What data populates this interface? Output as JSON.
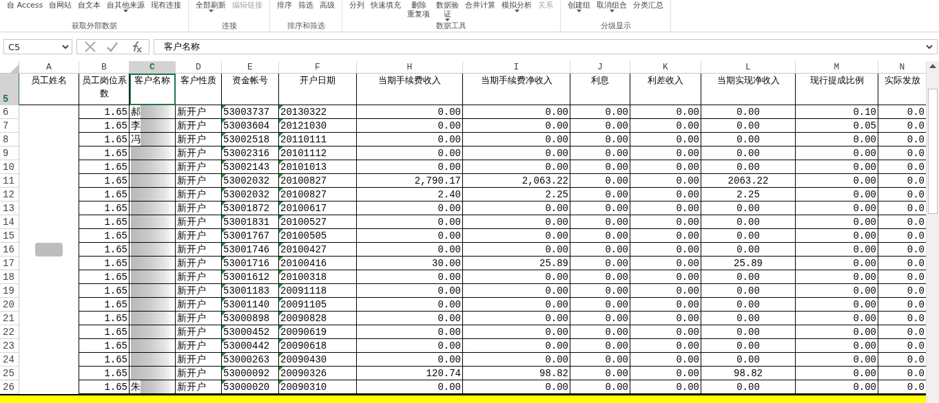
{
  "ribbon": {
    "groups": [
      {
        "label": "获取外部数据",
        "commands": [
          {
            "lines": [
              "自 Access"
            ],
            "dropdown": false,
            "disabled": false
          },
          {
            "lines": [
              "自网站"
            ],
            "dropdown": false,
            "disabled": false
          },
          {
            "lines": [
              "自文本"
            ],
            "dropdown": false,
            "disabled": false
          },
          {
            "lines": [
              "自其他来源"
            ],
            "dropdown": true,
            "disabled": false
          },
          {
            "lines": [
              "现有连接"
            ],
            "dropdown": false,
            "disabled": false
          }
        ]
      },
      {
        "label": "连接",
        "commands": [
          {
            "lines": [
              "全部刷新"
            ],
            "dropdown": true,
            "disabled": false
          },
          {
            "lines": [
              "编辑链接"
            ],
            "dropdown": false,
            "disabled": true
          }
        ]
      },
      {
        "label": "排序和筛选",
        "commands": [
          {
            "lines": [
              "排序"
            ],
            "dropdown": false,
            "disabled": false
          },
          {
            "lines": [
              "筛选"
            ],
            "dropdown": false,
            "disabled": false
          },
          {
            "lines": [
              "高级"
            ],
            "dropdown": false,
            "disabled": false
          }
        ]
      },
      {
        "label": "数据工具",
        "commands": [
          {
            "lines": [
              "分列"
            ],
            "dropdown": false,
            "disabled": false
          },
          {
            "lines": [
              "快速填充"
            ],
            "dropdown": false,
            "disabled": false
          },
          {
            "lines": [
              "删除",
              "重复项"
            ],
            "dropdown": false,
            "disabled": false
          },
          {
            "lines": [
              "数据验",
              "证"
            ],
            "dropdown": true,
            "disabled": false
          },
          {
            "lines": [
              "合并计算"
            ],
            "dropdown": false,
            "disabled": false
          },
          {
            "lines": [
              "模拟分析"
            ],
            "dropdown": true,
            "disabled": false
          },
          {
            "lines": [
              "关系"
            ],
            "dropdown": false,
            "disabled": true
          }
        ]
      },
      {
        "label": "分级显示",
        "commands": [
          {
            "lines": [
              "创建组"
            ],
            "dropdown": true,
            "disabled": false
          },
          {
            "lines": [
              "取消组合"
            ],
            "dropdown": true,
            "disabled": false
          },
          {
            "lines": [
              "分类汇总"
            ],
            "dropdown": false,
            "disabled": false
          }
        ]
      }
    ]
  },
  "formula_bar": {
    "name_box": "C5",
    "formula": "客户名称"
  },
  "columns": [
    {
      "letter": "A",
      "selected": false
    },
    {
      "letter": "B",
      "selected": false
    },
    {
      "letter": "C",
      "selected": true
    },
    {
      "letter": "D",
      "selected": false
    },
    {
      "letter": "E",
      "selected": false
    },
    {
      "letter": "F",
      "selected": false
    },
    {
      "letter": "H",
      "selected": false
    },
    {
      "letter": "I",
      "selected": false
    },
    {
      "letter": "J",
      "selected": false
    },
    {
      "letter": "K",
      "selected": false
    },
    {
      "letter": "L",
      "selected": false
    },
    {
      "letter": "M",
      "selected": false
    },
    {
      "letter": "N",
      "selected": false
    }
  ],
  "header_row": {
    "number": "5",
    "selected": true,
    "labels": [
      "员工姓名",
      "员工岗位系数",
      "客户名称",
      "客户性质",
      "资金帐号",
      "开户日期",
      "当期手续费收入",
      "当期手续费净收入",
      "利息",
      "利差收入",
      "当期实现净收入",
      "现行提成比例",
      "实际发放"
    ]
  },
  "rows": [
    {
      "number": "6",
      "coef": "1.65",
      "customer": "郝",
      "nature": "新开户",
      "account": "53003737",
      "date": "20130322",
      "fee": "0.00",
      "net_fee": "0.00",
      "interest": "0.00",
      "spread": "0.00",
      "net_income": "0.00",
      "rate": "0.10",
      "actual": "0.0"
    },
    {
      "number": "7",
      "coef": "1.65",
      "customer": "李",
      "nature": "新开户",
      "account": "53003604",
      "date": "20121030",
      "fee": "0.00",
      "net_fee": "0.00",
      "interest": "0.00",
      "spread": "0.00",
      "net_income": "0.00",
      "rate": "0.05",
      "actual": "0.0"
    },
    {
      "number": "8",
      "coef": "1.65",
      "customer": "冯",
      "nature": "新开户",
      "account": "53002518",
      "date": "20110111",
      "fee": "0.00",
      "net_fee": "0.00",
      "interest": "0.00",
      "spread": "0.00",
      "net_income": "0.00",
      "rate": "0.00",
      "actual": "0.0"
    },
    {
      "number": "9",
      "coef": "1.65",
      "nature": "新开户",
      "account": "53002316",
      "date": "20101112",
      "fee": "0.00",
      "net_fee": "0.00",
      "interest": "0.00",
      "spread": "0.00",
      "net_income": "0.00",
      "rate": "0.00",
      "actual": "0.0"
    },
    {
      "number": "10",
      "coef": "1.65",
      "nature": "新开户",
      "account": "53002143",
      "date": "20101013",
      "fee": "0.00",
      "net_fee": "0.00",
      "interest": "0.00",
      "spread": "0.00",
      "net_income": "0.00",
      "rate": "0.00",
      "actual": "0.0"
    },
    {
      "number": "11",
      "coef": "1.65",
      "nature": "新开户",
      "account": "53002032",
      "date": "20100827",
      "fee": "2,790.17",
      "net_fee": "2,063.22",
      "interest": "0.00",
      "spread": "0.00",
      "net_income": "2063.22",
      "rate": "0.00",
      "actual": "0.0"
    },
    {
      "number": "12",
      "coef": "1.65",
      "nature": "新开户",
      "account": "53002032",
      "date": "20100827",
      "fee": "2.40",
      "net_fee": "2.25",
      "interest": "0.00",
      "spread": "0.00",
      "net_income": "2.25",
      "rate": "0.00",
      "actual": "0.0"
    },
    {
      "number": "13",
      "coef": "1.65",
      "nature": "新开户",
      "account": "53001872",
      "date": "20100617",
      "fee": "0.00",
      "net_fee": "0.00",
      "interest": "0.00",
      "spread": "0.00",
      "net_income": "0.00",
      "rate": "0.00",
      "actual": "0.0"
    },
    {
      "number": "14",
      "coef": "1.65",
      "nature": "新开户",
      "account": "53001831",
      "date": "20100527",
      "fee": "0.00",
      "net_fee": "0.00",
      "interest": "0.00",
      "spread": "0.00",
      "net_income": "0.00",
      "rate": "0.00",
      "actual": "0.0"
    },
    {
      "number": "15",
      "coef": "1.65",
      "nature": "新开户",
      "account": "53001767",
      "date": "20100505",
      "fee": "0.00",
      "net_fee": "0.00",
      "interest": "0.00",
      "spread": "0.00",
      "net_income": "0.00",
      "rate": "0.00",
      "actual": "0.0"
    },
    {
      "number": "16",
      "coef": "1.65",
      "nature": "新开户",
      "account": "53001746",
      "date": "20100427",
      "fee": "0.00",
      "net_fee": "0.00",
      "interest": "0.00",
      "spread": "0.00",
      "net_income": "0.00",
      "rate": "0.00",
      "actual": "0.0"
    },
    {
      "number": "17",
      "coef": "1.65",
      "nature": "新开户",
      "account": "53001716",
      "date": "20100416",
      "fee": "30.00",
      "net_fee": "25.89",
      "interest": "0.00",
      "spread": "0.00",
      "net_income": "25.89",
      "rate": "0.00",
      "actual": "0.0"
    },
    {
      "number": "18",
      "coef": "1.65",
      "nature": "新开户",
      "account": "53001612",
      "date": "20100318",
      "fee": "0.00",
      "net_fee": "0.00",
      "interest": "0.00",
      "spread": "0.00",
      "net_income": "0.00",
      "rate": "0.00",
      "actual": "0.0"
    },
    {
      "number": "19",
      "coef": "1.65",
      "nature": "新开户",
      "account": "53001183",
      "date": "20091118",
      "fee": "0.00",
      "net_fee": "0.00",
      "interest": "0.00",
      "spread": "0.00",
      "net_income": "0.00",
      "rate": "0.00",
      "actual": "0.0"
    },
    {
      "number": "20",
      "coef": "1.65",
      "nature": "新开户",
      "account": "53001140",
      "date": "20091105",
      "fee": "0.00",
      "net_fee": "0.00",
      "interest": "0.00",
      "spread": "0.00",
      "net_income": "0.00",
      "rate": "0.00",
      "actual": "0.0"
    },
    {
      "number": "21",
      "coef": "1.65",
      "nature": "新开户",
      "account": "53000898",
      "date": "20090828",
      "fee": "0.00",
      "net_fee": "0.00",
      "interest": "0.00",
      "spread": "0.00",
      "net_income": "0.00",
      "rate": "0.00",
      "actual": "0.0"
    },
    {
      "number": "22",
      "coef": "1.65",
      "nature": "新开户",
      "account": "53000452",
      "date": "20090619",
      "fee": "0.00",
      "net_fee": "0.00",
      "interest": "0.00",
      "spread": "0.00",
      "net_income": "0.00",
      "rate": "0.00",
      "actual": "0.0"
    },
    {
      "number": "23",
      "coef": "1.65",
      "nature": "新开户",
      "account": "53000442",
      "date": "20090618",
      "fee": "0.00",
      "net_fee": "0.00",
      "interest": "0.00",
      "spread": "0.00",
      "net_income": "0.00",
      "rate": "0.00",
      "actual": "0.0"
    },
    {
      "number": "24",
      "coef": "1.65",
      "nature": "新开户",
      "account": "53000263",
      "date": "20090430",
      "fee": "0.00",
      "net_fee": "0.00",
      "interest": "0.00",
      "spread": "0.00",
      "net_income": "0.00",
      "rate": "0.00",
      "actual": "0.0"
    },
    {
      "number": "25",
      "coef": "1.65",
      "nature": "新开户",
      "account": "53000092",
      "date": "20090326",
      "fee": "120.74",
      "net_fee": "98.82",
      "interest": "0.00",
      "spread": "0.00",
      "net_income": "98.82",
      "rate": "0.00",
      "actual": "0.0"
    },
    {
      "number": "26",
      "coef": "1.65",
      "customer": "朱",
      "nature": "新开户",
      "account": "53000020",
      "date": "20090310",
      "fee": "0.00",
      "net_fee": "0.00",
      "interest": "0.00",
      "spread": "0.00",
      "net_income": "0.00",
      "rate": "0.00",
      "actual": "0.0"
    }
  ]
}
